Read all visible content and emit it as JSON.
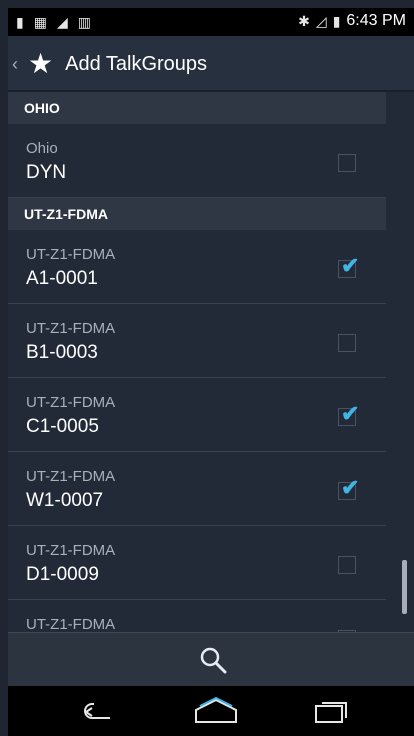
{
  "status": {
    "time": "6:43 PM"
  },
  "actionbar": {
    "title": "Add TalkGroups",
    "back_icon": "chevron-left-icon",
    "app_icon": "star-icon"
  },
  "sections": [
    {
      "header": "OHIO",
      "items": [
        {
          "group": "Ohio",
          "name": "DYN",
          "checked": false
        }
      ]
    },
    {
      "header": "UT-Z1-FDMA",
      "items": [
        {
          "group": "UT-Z1-FDMA",
          "name": "A1-0001",
          "checked": true
        },
        {
          "group": "UT-Z1-FDMA",
          "name": "B1-0003",
          "checked": false
        },
        {
          "group": "UT-Z1-FDMA",
          "name": "C1-0005",
          "checked": true
        },
        {
          "group": "UT-Z1-FDMA",
          "name": "W1-0007",
          "checked": true
        },
        {
          "group": "UT-Z1-FDMA",
          "name": "D1-0009",
          "checked": false
        },
        {
          "group": "UT-Z1-FDMA",
          "name": "",
          "checked": false
        }
      ]
    }
  ],
  "bottom": {
    "search_icon": "search-icon"
  },
  "navigation": {
    "back_icon": "back-icon",
    "home_icon": "home-icon",
    "recents_icon": "recents-icon"
  },
  "colors": {
    "accent": "#41b4e6",
    "background": "#222a37",
    "section": "#2f3745"
  }
}
